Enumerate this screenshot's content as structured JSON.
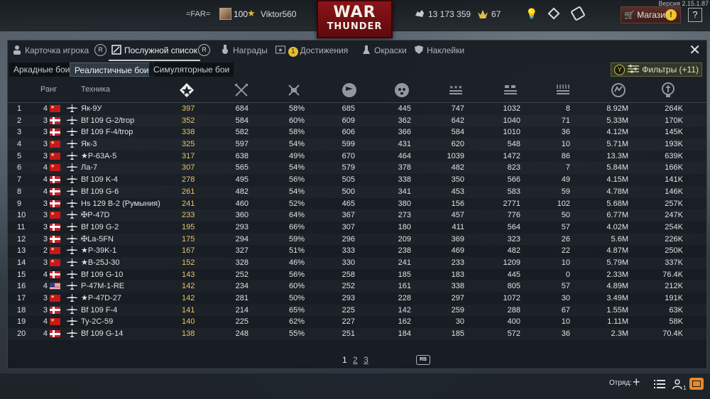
{
  "version": "Версия 2.15.1.87",
  "topbar": {
    "clan": "=FAR=",
    "level": "100",
    "nickname": "Viktor560",
    "logo_line1": "WAR",
    "logo_line2": "THUNDER",
    "silver_lions": "13 173 359",
    "golden_eagles": "67",
    "shop_label": "Магазин",
    "shop_alert": "!",
    "help_label": "?"
  },
  "tabs": [
    {
      "label": "Карточка игрока",
      "icon": "player-card-icon"
    },
    {
      "label": "Послужной список",
      "icon": "service-record-icon",
      "active": true
    },
    {
      "label": "Награды",
      "icon": "medal-icon"
    },
    {
      "label": "Достижения",
      "icon": "achievements-icon",
      "badge": "1"
    },
    {
      "label": "Окраски",
      "icon": "camouflage-icon"
    },
    {
      "label": "Наклейки",
      "icon": "decal-icon"
    }
  ],
  "tab_keys": {
    "left": "R",
    "right": "R"
  },
  "modes": [
    {
      "label": "Аркадные бои"
    },
    {
      "label": "Реалистичные бои",
      "active": true
    },
    {
      "label": "Симуляторные бои"
    }
  ],
  "filters": {
    "key": "Y",
    "label": "Фильтры (+11)"
  },
  "table": {
    "headers": {
      "rank": "Ранг",
      "vehicle": "Техника"
    },
    "header_icons": [
      "battles-icon",
      "air-kills-icon",
      "ground-kills-icon",
      "flag-icon",
      "deaths-icon",
      "air-targets-icon",
      "ground-targets-icon",
      "naval-targets-icon",
      "activity-icon",
      "silver-icon"
    ],
    "rows": [
      {
        "n": "1",
        "rank": "4",
        "country": "ussr",
        "name": "Як-9У",
        "score": "397",
        "b": "684",
        "c": "58%",
        "d": "685",
        "e": "445",
        "f": "747",
        "g": "1032",
        "h": "8",
        "i": "8.92M",
        "j": "264K"
      },
      {
        "n": "2",
        "rank": "3",
        "country": "nor",
        "name": "Bf 109 G-2/trop",
        "score": "352",
        "b": "584",
        "c": "60%",
        "d": "609",
        "e": "362",
        "f": "642",
        "g": "1040",
        "h": "71",
        "i": "5.33M",
        "j": "170K"
      },
      {
        "n": "3",
        "rank": "3",
        "country": "nor",
        "name": "Bf 109 F-4/trop",
        "score": "338",
        "b": "582",
        "c": "58%",
        "d": "606",
        "e": "366",
        "f": "584",
        "g": "1010",
        "h": "36",
        "i": "4.12M",
        "j": "145K"
      },
      {
        "n": "4",
        "rank": "3",
        "country": "ussr",
        "name": "Як-3",
        "score": "325",
        "b": "597",
        "c": "54%",
        "d": "599",
        "e": "431",
        "f": "620",
        "g": "548",
        "h": "10",
        "i": "5.71M",
        "j": "193K"
      },
      {
        "n": "5",
        "rank": "3",
        "country": "ussr",
        "name": "★P-63A-5",
        "score": "317",
        "b": "638",
        "c": "49%",
        "d": "670",
        "e": "464",
        "f": "1039",
        "g": "1472",
        "h": "86",
        "i": "13.3M",
        "j": "639K"
      },
      {
        "n": "6",
        "rank": "4",
        "country": "ussr",
        "name": "Ла-7",
        "score": "307",
        "b": "565",
        "c": "54%",
        "d": "579",
        "e": "378",
        "f": "482",
        "g": "823",
        "h": "7",
        "i": "5.84M",
        "j": "166K"
      },
      {
        "n": "7",
        "rank": "4",
        "country": "nor",
        "name": "Bf 109 K-4",
        "score": "278",
        "b": "495",
        "c": "56%",
        "d": "505",
        "e": "338",
        "f": "350",
        "g": "566",
        "h": "49",
        "i": "4.15M",
        "j": "141K"
      },
      {
        "n": "8",
        "rank": "4",
        "country": "nor",
        "name": "Bf 109 G-6",
        "score": "261",
        "b": "482",
        "c": "54%",
        "d": "500",
        "e": "341",
        "f": "453",
        "g": "583",
        "h": "59",
        "i": "4.78M",
        "j": "146K"
      },
      {
        "n": "9",
        "rank": "3",
        "country": "nor",
        "name": "Hs 129 B-2 (Румыния)",
        "score": "241",
        "b": "460",
        "c": "52%",
        "d": "465",
        "e": "380",
        "f": "156",
        "g": "2771",
        "h": "102",
        "i": "5.68M",
        "j": "257K"
      },
      {
        "n": "10",
        "rank": "3",
        "country": "ussr",
        "name": "✠P-47D",
        "score": "233",
        "b": "360",
        "c": "64%",
        "d": "367",
        "e": "273",
        "f": "457",
        "g": "776",
        "h": "50",
        "i": "6.77M",
        "j": "247K"
      },
      {
        "n": "11",
        "rank": "3",
        "country": "nor",
        "name": "Bf 109 G-2",
        "score": "195",
        "b": "293",
        "c": "66%",
        "d": "307",
        "e": "180",
        "f": "411",
        "g": "564",
        "h": "57",
        "i": "4.02M",
        "j": "254K"
      },
      {
        "n": "12",
        "rank": "3",
        "country": "nor",
        "name": "✠La-5FN",
        "score": "175",
        "b": "294",
        "c": "59%",
        "d": "296",
        "e": "209",
        "f": "369",
        "g": "323",
        "h": "26",
        "i": "5.6M",
        "j": "226K"
      },
      {
        "n": "13",
        "rank": "2",
        "country": "ussr",
        "name": "★P-39K-1",
        "score": "167",
        "b": "327",
        "c": "51%",
        "d": "333",
        "e": "238",
        "f": "469",
        "g": "482",
        "h": "22",
        "i": "4.87M",
        "j": "250K"
      },
      {
        "n": "14",
        "rank": "3",
        "country": "ussr",
        "name": "★B-25J-30",
        "score": "152",
        "b": "328",
        "c": "46%",
        "d": "330",
        "e": "241",
        "f": "233",
        "g": "1209",
        "h": "10",
        "i": "5.79M",
        "j": "337K"
      },
      {
        "n": "15",
        "rank": "4",
        "country": "nor",
        "name": "Bf 109 G-10",
        "score": "143",
        "b": "252",
        "c": "56%",
        "d": "258",
        "e": "185",
        "f": "183",
        "g": "445",
        "h": "0",
        "i": "2.33M",
        "j": "76.4K"
      },
      {
        "n": "16",
        "rank": "4",
        "country": "usa",
        "name": "P-47M-1-RE",
        "score": "142",
        "b": "234",
        "c": "60%",
        "d": "252",
        "e": "161",
        "f": "338",
        "g": "805",
        "h": "57",
        "i": "4.89M",
        "j": "212K"
      },
      {
        "n": "17",
        "rank": "3",
        "country": "ussr",
        "name": "★P-47D-27",
        "score": "142",
        "b": "281",
        "c": "50%",
        "d": "293",
        "e": "228",
        "f": "297",
        "g": "1072",
        "h": "30",
        "i": "3.49M",
        "j": "191K"
      },
      {
        "n": "18",
        "rank": "3",
        "country": "nor",
        "name": "Bf 109 F-4",
        "score": "141",
        "b": "214",
        "c": "65%",
        "d": "225",
        "e": "142",
        "f": "259",
        "g": "288",
        "h": "67",
        "i": "1.55M",
        "j": "63K"
      },
      {
        "n": "19",
        "rank": "4",
        "country": "ussr",
        "name": "Ту-2С-59",
        "score": "140",
        "b": "225",
        "c": "62%",
        "d": "227",
        "e": "162",
        "f": "30",
        "g": "400",
        "h": "10",
        "i": "1.11M",
        "j": "58K"
      },
      {
        "n": "20",
        "rank": "4",
        "country": "nor",
        "name": "Bf 109 G-14",
        "score": "138",
        "b": "248",
        "c": "55%",
        "d": "251",
        "e": "184",
        "f": "185",
        "g": "572",
        "h": "36",
        "i": "2.3M",
        "j": "70.4K"
      }
    ]
  },
  "pager": {
    "current": "1",
    "pages": [
      "2",
      "3"
    ],
    "key": "RB"
  },
  "bottom": {
    "squad_label": "Отряд:",
    "friends_count": "1"
  }
}
